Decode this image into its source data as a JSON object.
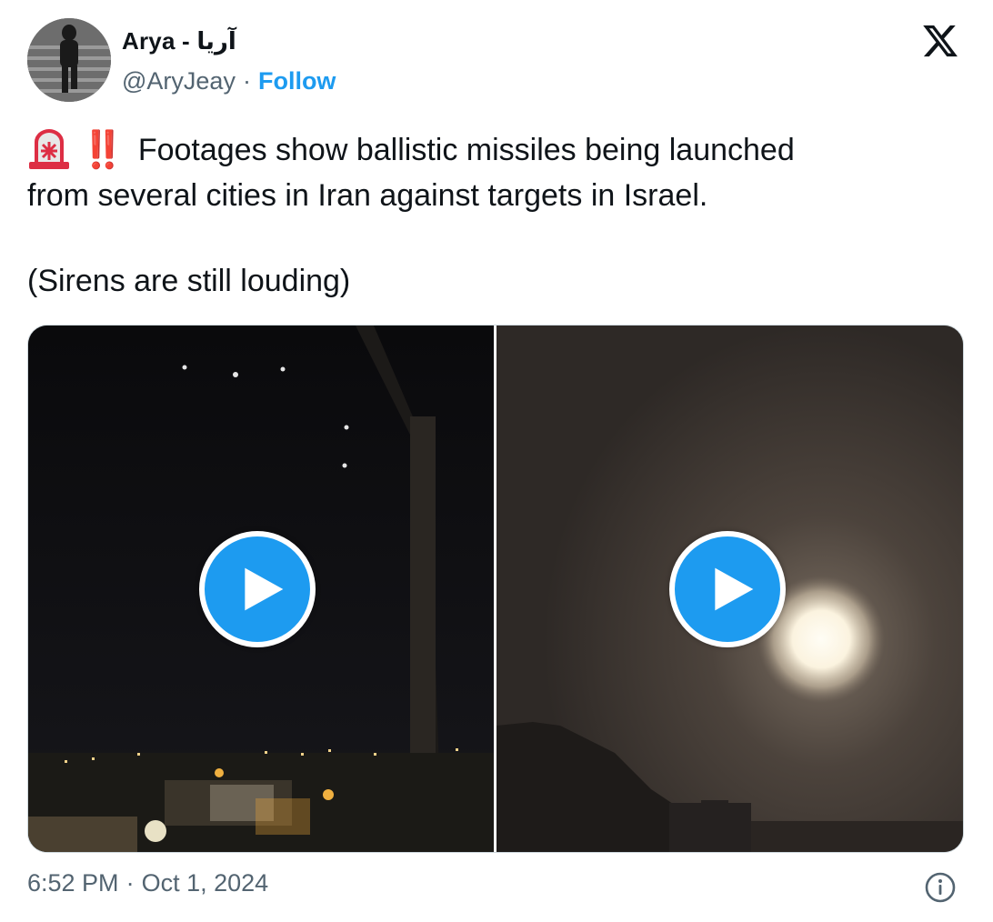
{
  "author": {
    "display_name": "Arya - آریا",
    "handle": "@AryJeay",
    "separator": "·",
    "follow_label": "Follow"
  },
  "tweet": {
    "emoji_prefix": "🚨",
    "exclamation": "‼️",
    "line1": "Footages show ballistic missiles being launched",
    "line2": "from several cities in Iran against targets in Israel.",
    "line3": "(Sirens are still louding)"
  },
  "media": {
    "items": [
      {
        "type": "video",
        "icon": "play-icon"
      },
      {
        "type": "video",
        "icon": "play-icon"
      }
    ]
  },
  "footer": {
    "time": "6:52 PM",
    "separator": "·",
    "date": "Oct 1, 2024",
    "info_icon": "info-icon"
  },
  "colors": {
    "accent": "#1d9bf0",
    "text_primary": "#0f1419",
    "text_secondary": "#536471",
    "border": "#cfd9de"
  }
}
